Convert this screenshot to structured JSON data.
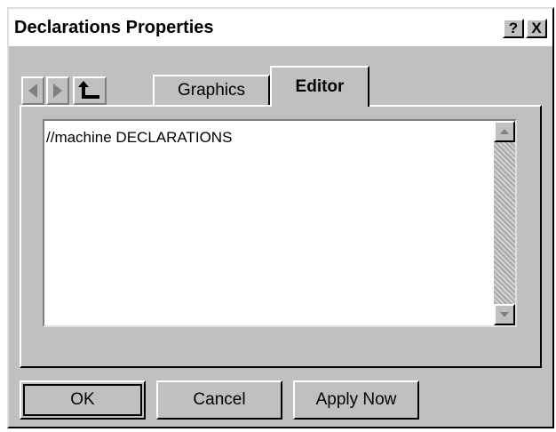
{
  "window": {
    "title": "Declarations Properties",
    "help_label": "?",
    "close_label": "X"
  },
  "nav": {
    "back_icon": "back-arrow-icon",
    "forward_icon": "forward-arrow-icon",
    "up_icon": "up-level-icon"
  },
  "tabs": [
    {
      "label": "Graphics",
      "active": false
    },
    {
      "label": "Editor",
      "active": true
    }
  ],
  "editor": {
    "text": "//machine DECLARATIONS"
  },
  "buttons": {
    "ok": "OK",
    "cancel": "Cancel",
    "apply": "Apply Now"
  }
}
